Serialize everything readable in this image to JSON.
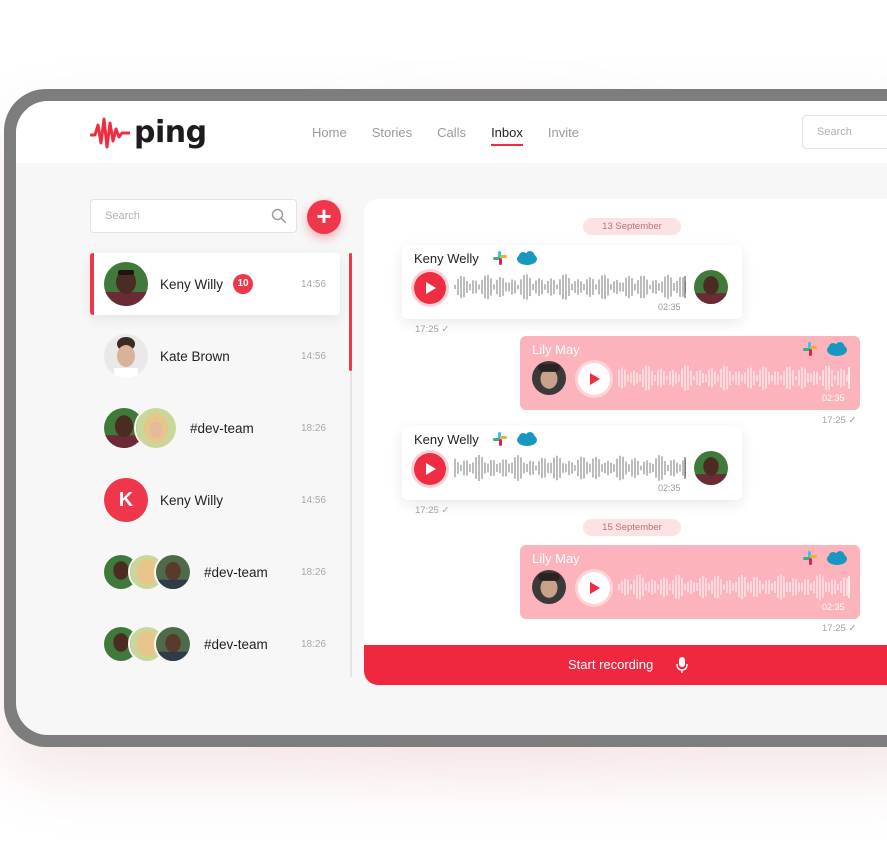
{
  "brand": {
    "name": "ping",
    "accent": "#f0364b"
  },
  "nav": {
    "items": [
      "Home",
      "Stories",
      "Calls",
      "Inbox",
      "Invite"
    ],
    "active": "Inbox"
  },
  "top_search": {
    "placeholder": "Search"
  },
  "sidebar": {
    "search_placeholder": "Search",
    "add_icon": "plus-icon",
    "conversations": [
      {
        "name": "Keny Willy",
        "badge": "10",
        "time": "14:56",
        "avatar": "photo",
        "active": true
      },
      {
        "name": "Kate Brown",
        "time": "14:56",
        "avatar": "photo"
      },
      {
        "name": "#dev-team",
        "time": "18:26",
        "avatar": "group-2"
      },
      {
        "name": "Keny Willy",
        "time": "14:56",
        "avatar": "letter",
        "letter": "K"
      },
      {
        "name": "#dev-team",
        "time": "18:26",
        "avatar": "group-3"
      },
      {
        "name": "#dev-team",
        "time": "18:26",
        "avatar": "group-3"
      }
    ]
  },
  "chat": {
    "dates": [
      "13 September",
      "15 September"
    ],
    "messages": [
      {
        "direction": "in",
        "sender": "Keny Welly",
        "duration": "02:35",
        "time": "17:25",
        "apps": [
          "slack-icon",
          "salesforce-icon"
        ]
      },
      {
        "direction": "out",
        "sender": "Lily May",
        "duration": "02:35",
        "time": "17:25",
        "apps": [
          "slack-icon",
          "salesforce-icon"
        ]
      },
      {
        "direction": "in",
        "sender": "Keny Welly",
        "duration": "02:35",
        "time": "17:25",
        "apps": [
          "slack-icon",
          "salesforce-icon"
        ]
      },
      {
        "direction": "out",
        "sender": "Lily May",
        "duration": "02:35",
        "time": "17:25",
        "apps": [
          "slack-icon",
          "salesforce-icon"
        ]
      }
    ],
    "record_label": "Start recording"
  }
}
